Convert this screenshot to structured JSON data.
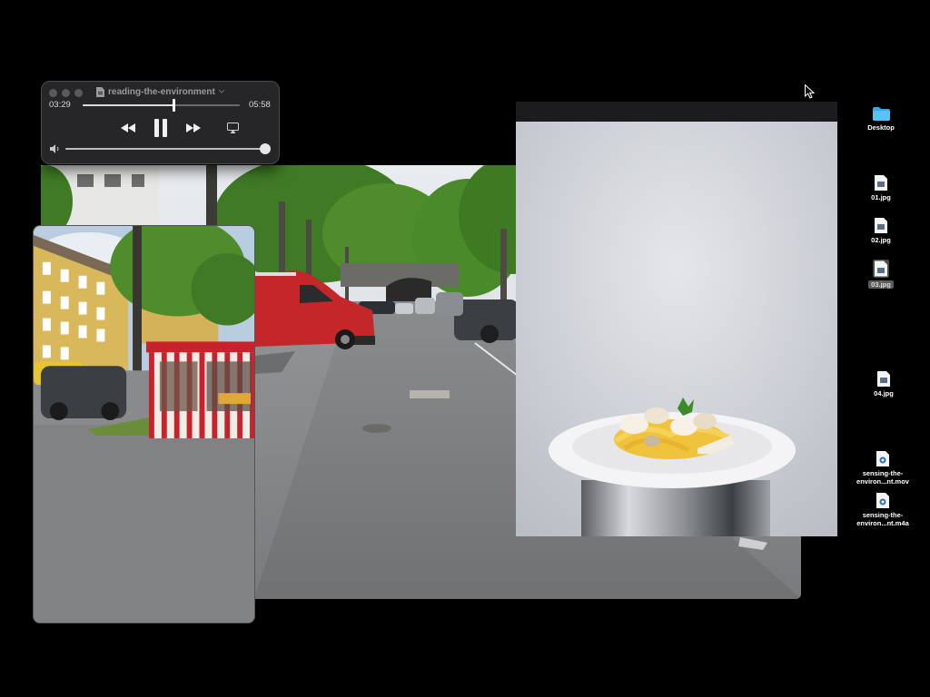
{
  "player": {
    "title": "reading-the-environment",
    "elapsed": "03:29",
    "duration": "05:58",
    "progress": 0.58,
    "volume": 1.0,
    "icons": {
      "rewind": "rewind-icon",
      "play_pause": "pause-icon",
      "forward": "fast-forward-icon",
      "airplay": "airplay-icon",
      "volume": "speaker-icon"
    }
  },
  "desktop": {
    "items": [
      {
        "label": "Desktop",
        "icon": "folder-icon",
        "selected": false
      },
      {
        "label": "01.jpg",
        "icon": "image-file-icon",
        "selected": false
      },
      {
        "label": "02.jpg",
        "icon": "image-file-icon",
        "selected": false
      },
      {
        "label": "03.jpg",
        "icon": "image-file-icon",
        "selected": true
      },
      {
        "label": "04.jpg",
        "icon": "image-file-icon",
        "selected": false
      },
      {
        "label": "sensing-the-\nenviron...nt.mov",
        "icon": "video-file-icon",
        "selected": false
      },
      {
        "label": "sensing-the-\nenviron...nt.m4a",
        "icon": "audio-file-icon",
        "selected": false
      }
    ]
  },
  "colors": {
    "folder": "#35a8e8",
    "van": "#c4262a",
    "facade": "#d9b85c",
    "awning_stripe": "#c8222c",
    "tree": "#4f8c2c"
  }
}
